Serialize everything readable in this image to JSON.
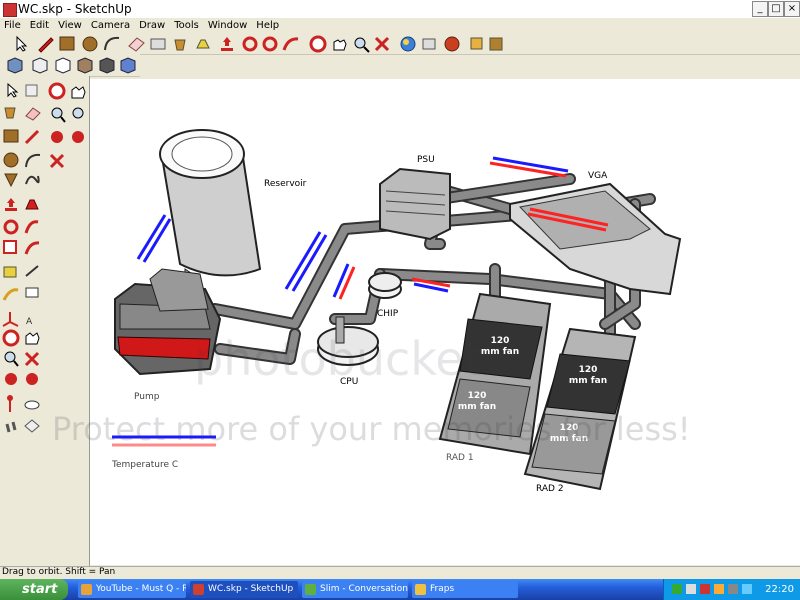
{
  "window": {
    "title": "WC.skp - SketchUp",
    "controls": {
      "minimize": "_",
      "maximize": "□",
      "close": "×"
    }
  },
  "menu": [
    "File",
    "Edit",
    "View",
    "Camera",
    "Draw",
    "Tools",
    "Window",
    "Help"
  ],
  "scene": {
    "labels": {
      "reservoir": "Reservoir",
      "psu": "PSU",
      "vga": "VGA",
      "chip": "CHIP",
      "cpu": "CPU",
      "pump": "Pump",
      "rad1": "RAD 1",
      "rad2": "RAD 2",
      "fan": "120 mm fan",
      "temperature": "Temperature C"
    },
    "legend_colors": {
      "cold": "#1a1aff",
      "hot": "#ff2222"
    }
  },
  "watermark": {
    "line1": "photobucket",
    "line2": "Protect more of your memories for less!"
  },
  "status": "Drag to orbit.  Shift = Pan",
  "taskbar": {
    "start": "start",
    "buttons": [
      {
        "label": "YouTube - Must Q - R...",
        "icon_color": "#e8a23a"
      },
      {
        "label": "WC.skp - SketchUp",
        "icon_color": "#d04030"
      },
      {
        "label": "Slim - Conversation",
        "icon_color": "#60b040"
      },
      {
        "label": "Fraps",
        "icon_color": "#f0c040"
      }
    ],
    "clock": "22:20"
  },
  "accent_colors": {
    "taskbar": "#245edb",
    "start": "#3a8f3a"
  }
}
